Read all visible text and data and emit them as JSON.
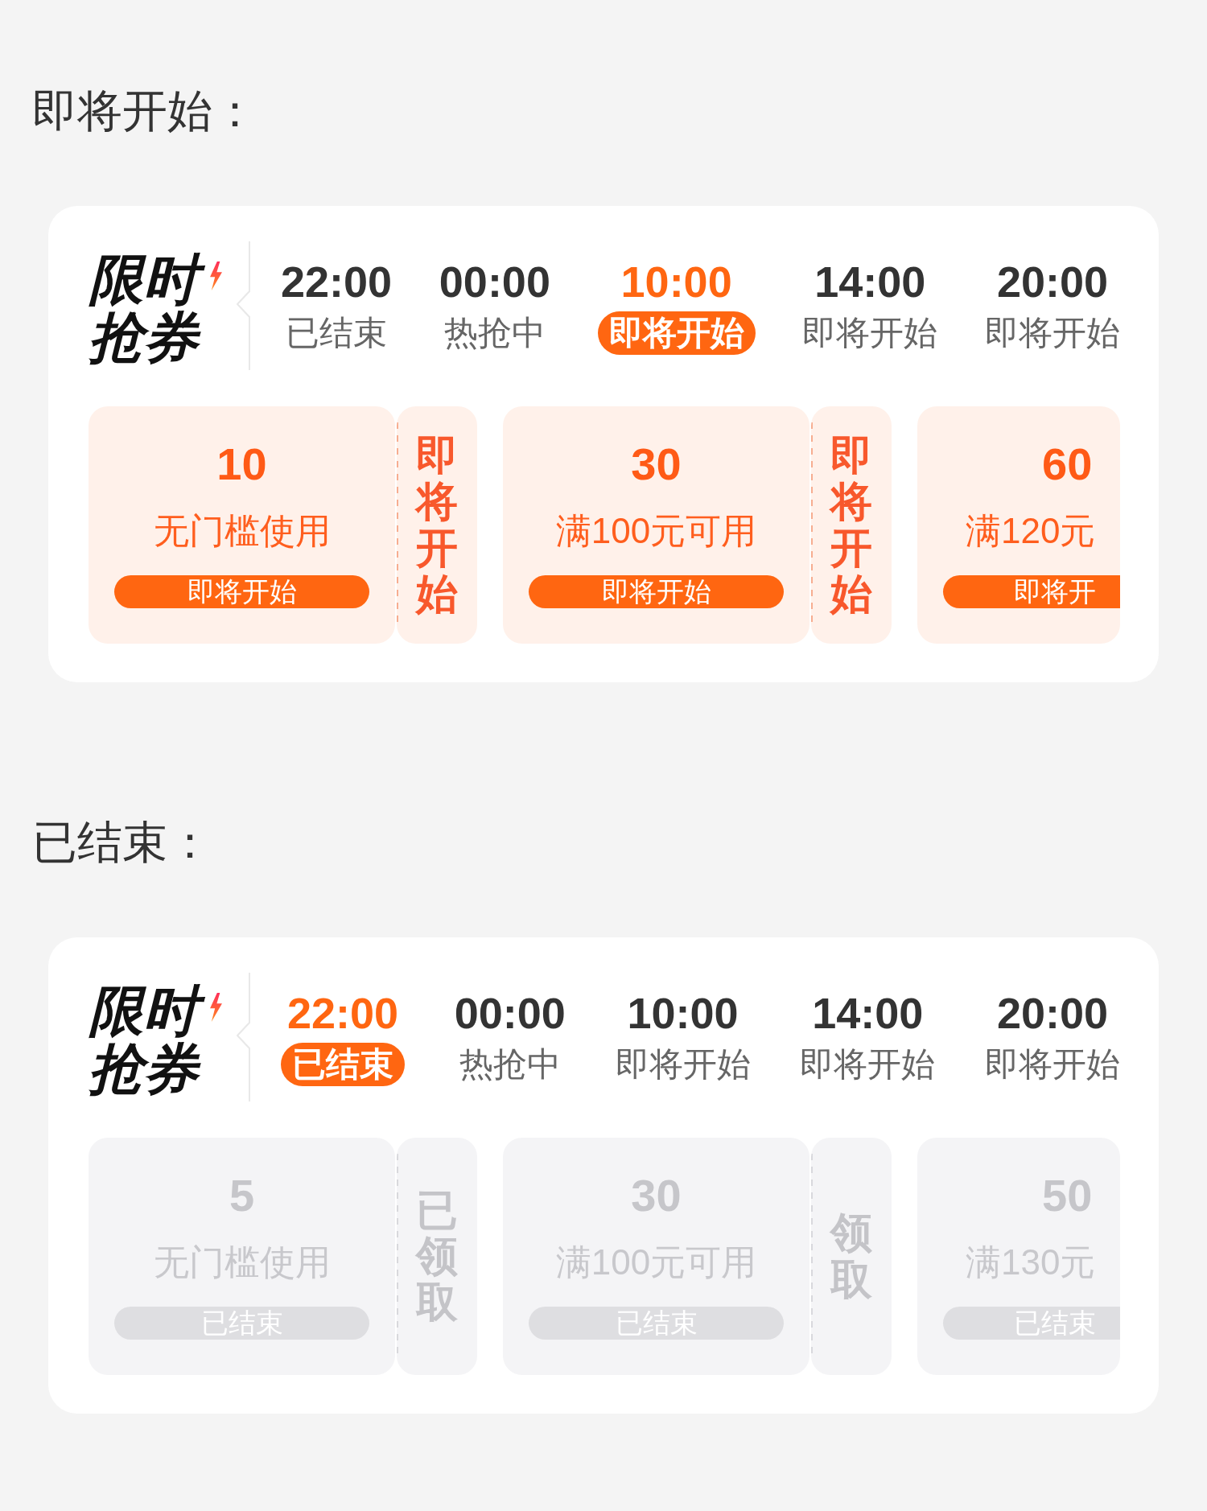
{
  "sections": [
    {
      "heading": "即将开始：",
      "card": {
        "logo": "限时抢券",
        "sessions": [
          {
            "time": "22:00",
            "status": "已结束",
            "selected": false
          },
          {
            "time": "00:00",
            "status": "热抢中",
            "selected": false
          },
          {
            "time": "10:00",
            "status": "即将开始",
            "selected": true
          },
          {
            "time": "14:00",
            "status": "即将开始",
            "selected": false
          },
          {
            "time": "20:00",
            "status": "即将开始",
            "selected": false
          }
        ],
        "coupons": [
          {
            "amount": "10",
            "condition": "无门槛使用",
            "button": "即将开始",
            "stub": "即将开始",
            "ended": false,
            "cut_off": false
          },
          {
            "amount": "30",
            "condition": "满100元可用",
            "button": "即将开始",
            "stub": "即将开始",
            "ended": false,
            "cut_off": false
          },
          {
            "amount": "60",
            "condition": "满120元",
            "button": "即将开",
            "ended": false,
            "cut_off": true
          }
        ]
      }
    },
    {
      "heading": "已结束：",
      "card": {
        "logo": "限时抢券",
        "sessions": [
          {
            "time": "22:00",
            "status": "已结束",
            "selected": true
          },
          {
            "time": "00:00",
            "status": "热抢中",
            "selected": false
          },
          {
            "time": "10:00",
            "status": "即将开始",
            "selected": false
          },
          {
            "time": "14:00",
            "status": "即将开始",
            "selected": false
          },
          {
            "time": "20:00",
            "status": "即将开始",
            "selected": false
          }
        ],
        "coupons": [
          {
            "amount": "5",
            "condition": "无门槛使用",
            "button": "已结束",
            "stub": "已领取",
            "ended": true,
            "cut_off": false
          },
          {
            "amount": "30",
            "condition": "满100元可用",
            "button": "已结束",
            "stub": "领取",
            "ended": true,
            "cut_off": false
          },
          {
            "amount": "50",
            "condition": "满130元",
            "button": "已结束",
            "ended": true,
            "cut_off": true
          }
        ]
      }
    }
  ]
}
